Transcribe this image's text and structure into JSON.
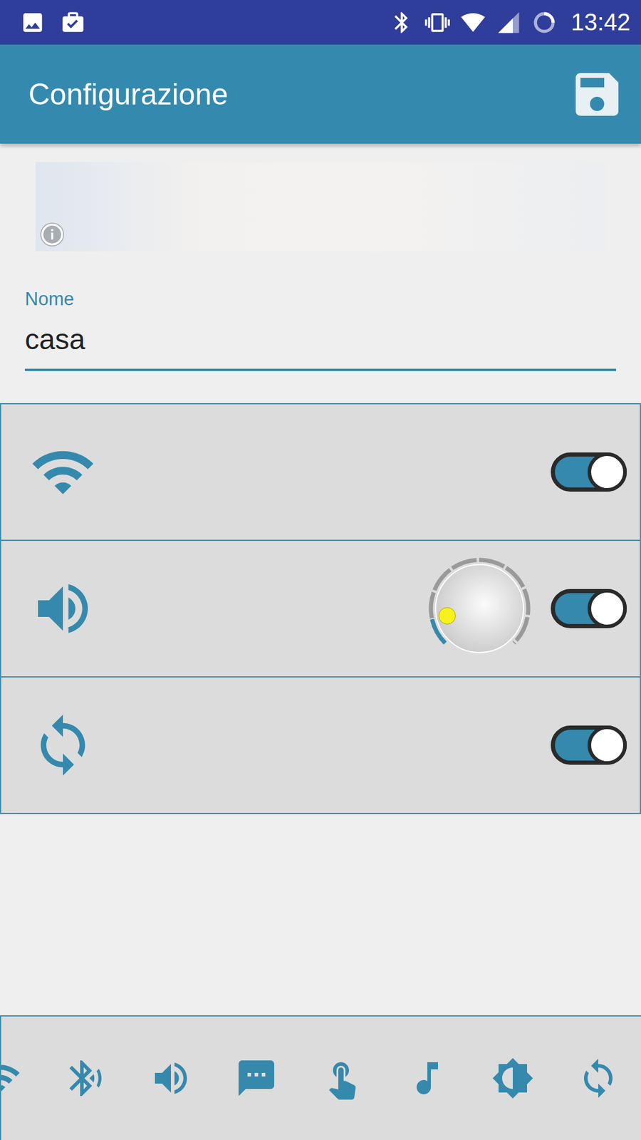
{
  "status_bar": {
    "time": "13:42"
  },
  "app_bar": {
    "title": "Configurazione"
  },
  "form": {
    "label": "Nome",
    "value": "casa"
  },
  "settings": [
    {
      "kind": "switch",
      "on": true
    },
    {
      "kind": "switch-with-knob",
      "on": true,
      "level": 0.12
    },
    {
      "kind": "switch",
      "on": true
    }
  ]
}
